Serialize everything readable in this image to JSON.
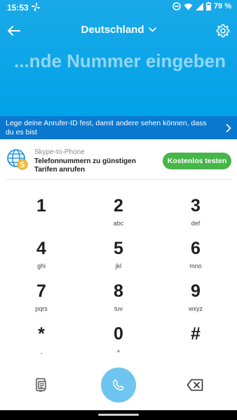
{
  "status_bar": {
    "time": "15:53",
    "battery_percent": "79 %"
  },
  "header": {
    "country": "Deutschland",
    "number_prompt": "...nde Nummer eingeben"
  },
  "caller_id_banner": {
    "text": "Lege deine Anrufer-ID fest, damit andere sehen können, dass du es bist"
  },
  "promo": {
    "kicker": "Skype-to-Phone",
    "text": "Telefonnummern zu günstigen Tarifen anrufen",
    "button_label": "Kostenlos testen"
  },
  "keypad": {
    "keys": [
      {
        "digit": "1",
        "letters": ""
      },
      {
        "digit": "2",
        "letters": "abc"
      },
      {
        "digit": "3",
        "letters": "def"
      },
      {
        "digit": "4",
        "letters": "ghi"
      },
      {
        "digit": "5",
        "letters": "jkl"
      },
      {
        "digit": "6",
        "letters": "mno"
      },
      {
        "digit": "7",
        "letters": "pqrs"
      },
      {
        "digit": "8",
        "letters": "tuv"
      },
      {
        "digit": "9",
        "letters": "wxyz"
      },
      {
        "digit": "*",
        "letters": ","
      },
      {
        "digit": "0",
        "letters": "+"
      },
      {
        "digit": "#",
        "letters": ""
      }
    ]
  },
  "icons": {
    "back": "arrow-left-icon",
    "settings": "gear-icon",
    "dropdown": "chevron-down-icon",
    "banner": "chevron-right-icon",
    "promo": "globe-coin-icon",
    "left_action": "phone-card-icon",
    "call": "phone-icon",
    "backspace": "backspace-icon"
  },
  "colors": {
    "header": "#00a2e8",
    "banner": "#0b78d0",
    "promo_button": "#47b54a",
    "call_button": "#6ec5ef"
  }
}
